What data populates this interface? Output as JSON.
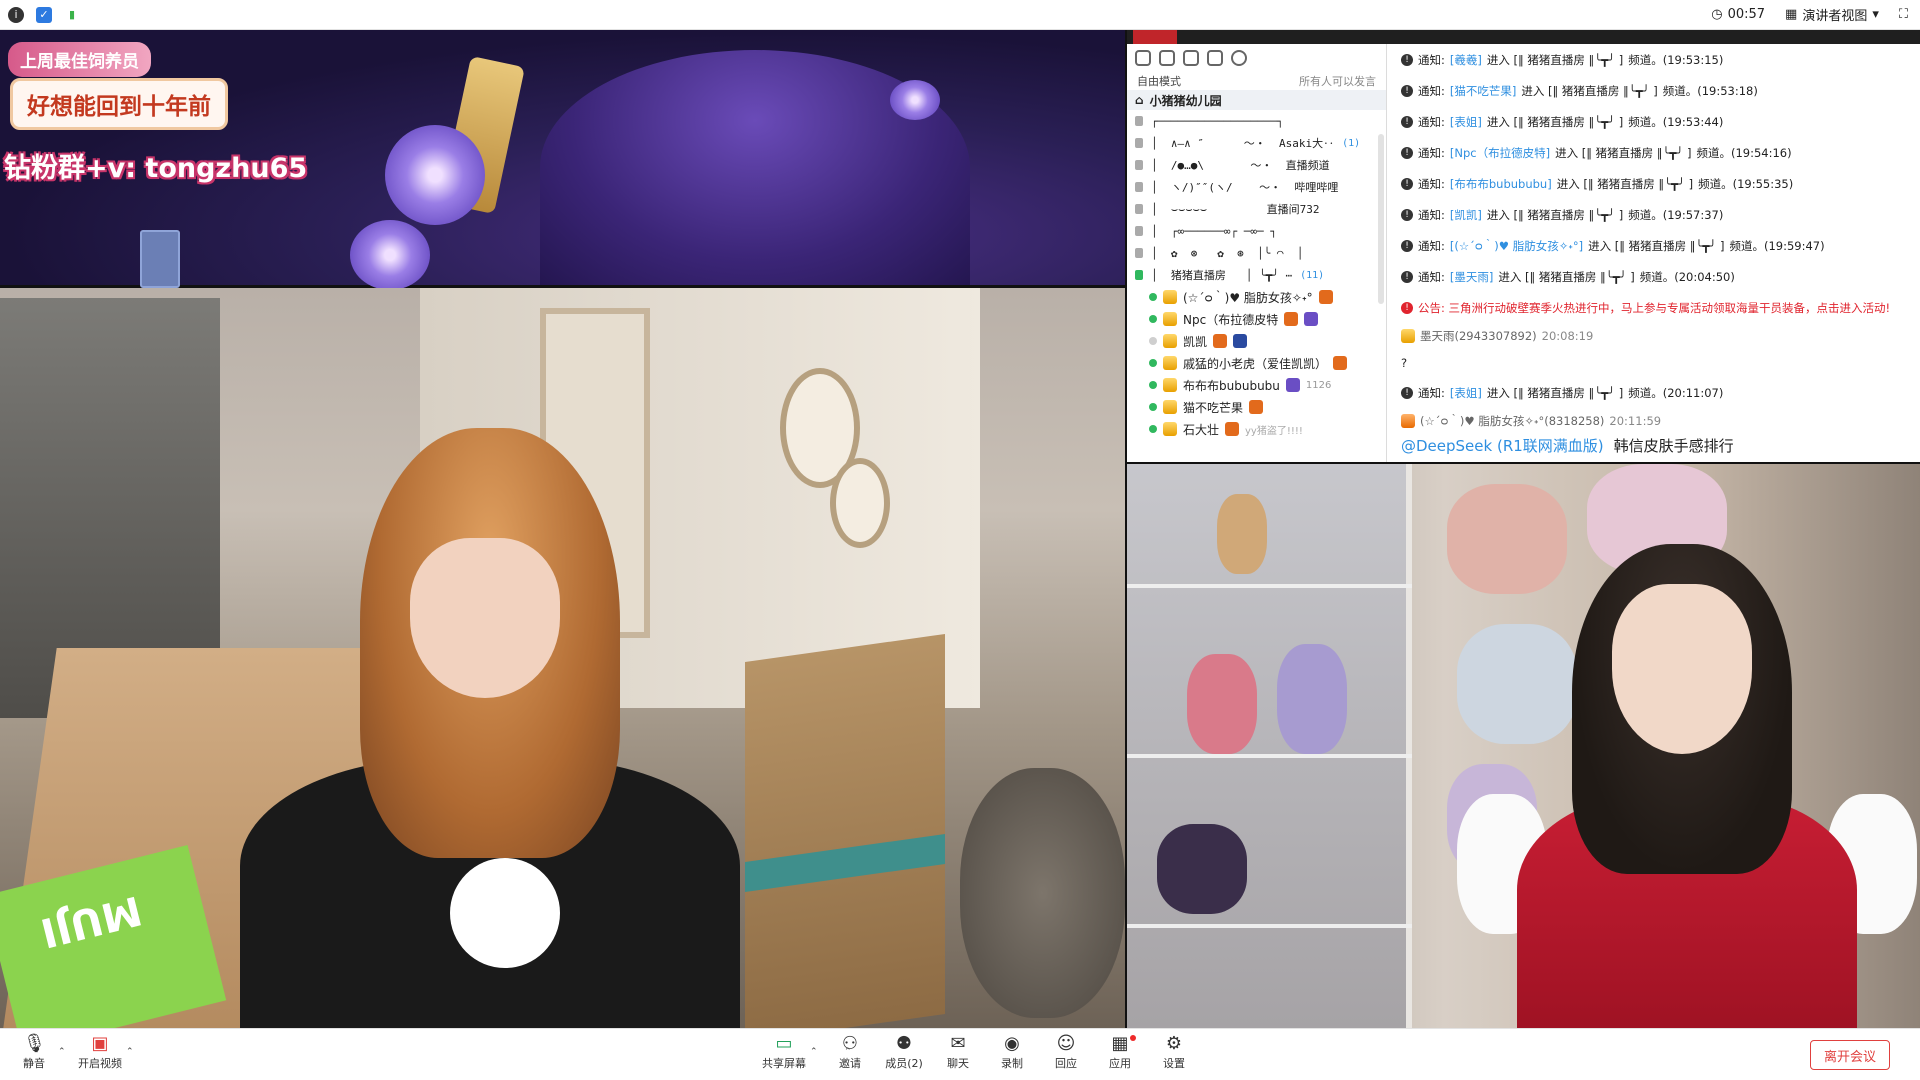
{
  "topbar": {
    "timer": "00:57",
    "view_label": "演讲者视图"
  },
  "left_video": {
    "overlay_title": "上周最佳饲养员",
    "overlay_slogan": "好想能回到十年前",
    "overlay_contact": "钻粉群+v: tongzhu65",
    "box_text": "MUJI"
  },
  "chat": {
    "mode_label": "自由模式",
    "mode_right": "所有人可以发言",
    "room_title": "小猪猪幼儿园",
    "art_rows": [
      "┌──────────────────┐",
      "│  ∧―∧ ″      ～・  Asaki大‥",
      "│  /●…●\\       ～・  直播频道",
      "│  ヽ/)″″(ヽ/    ～・  哔哩哔哩",
      "│  ⌣⌣⌣⌣⌣         直播间732",
      "│  ┌∞──────∞┌ ─∞─ ┐",
      "│  ✿  ⊛   ✿  ⊛  │╰ ◠  │"
    ],
    "art_extra": "(1)",
    "channel_row": {
      "text": "│  猪猪直播房   │ ╰┳╯ ⋯",
      "count": "(11)"
    },
    "members": [
      {
        "name": "(☆´ᴑ｀)♥ 脂肪女孩✧˖°",
        "online": true,
        "extra": ""
      },
      {
        "name": "Npc（布拉德皮特",
        "online": true,
        "extra": ""
      },
      {
        "name": "凯凯",
        "online": false,
        "extra": ""
      },
      {
        "name": "戚猛的小老虎（爱佳凯凯）",
        "online": true,
        "extra": ""
      },
      {
        "name": "布布布bubububu",
        "online": true,
        "extra": "1126"
      },
      {
        "name": "猫不吃芒果",
        "online": true,
        "extra": ""
      },
      {
        "name": "石大壮",
        "online": true,
        "extra": "yy猪盗了!!!!"
      }
    ],
    "messages": [
      {
        "type": "notice",
        "prefix": "通知:",
        "name": "[羲羲]",
        "mid": "进入 [‖ 猪猪直播房 ‖╰┳╯ ]",
        "suffix": "频道。(19:53:15)"
      },
      {
        "type": "notice",
        "prefix": "通知:",
        "name": "[猫不吃芒果]",
        "mid": "进入 [‖ 猪猪直播房 ‖╰┳╯ ]",
        "suffix": "频道。(19:53:18)"
      },
      {
        "type": "notice",
        "prefix": "通知:",
        "name": "[表姐]",
        "mid": "进入 [‖ 猪猪直播房 ‖╰┳╯ ]",
        "suffix": "频道。(19:53:44)"
      },
      {
        "type": "notice",
        "prefix": "通知:",
        "name": "[Npc（布拉德皮特]",
        "mid": "进入 [‖ 猪猪直播房 ‖╰┳╯ ]",
        "suffix": "频道。(19:54:16)"
      },
      {
        "type": "notice",
        "prefix": "通知:",
        "name": "[布布布bubububu]",
        "mid": "进入 [‖ 猪猪直播房 ‖╰┳╯ ]",
        "suffix": "频道。(19:55:35)"
      },
      {
        "type": "notice",
        "prefix": "通知:",
        "name": "[凯凯]",
        "mid": "进入 [‖ 猪猪直播房 ‖╰┳╯ ]",
        "suffix": "频道。(19:57:37)"
      },
      {
        "type": "notice",
        "prefix": "通知:",
        "name": "[(☆´ᴑ｀)♥ 脂肪女孩✧˖°]",
        "mid": "进入 [‖ 猪猪直播房 ‖╰┳╯ ]",
        "suffix": "频道。(19:59:47)"
      },
      {
        "type": "notice",
        "prefix": "通知:",
        "name": "[墨天雨]",
        "mid": "进入 [‖ 猪猪直播房 ‖╰┳╯ ]",
        "suffix": "频道。(20:04:50)"
      }
    ],
    "announcement": "公告: 三角洲行动破壁赛季火热进行中，马上参与专属活动领取海量干员装备，点击进入活动!",
    "user_msg": {
      "user": "墨天雨(2943307892)",
      "time": "20:08:19",
      "text": "?"
    },
    "notice_last": {
      "prefix": "通知:",
      "name": "[表姐]",
      "mid": "进入 [‖ 猪猪直播房 ‖╰┳╯ ]",
      "suffix": "频道。(20:11:07)"
    },
    "user_msg2": {
      "user": "(☆´ᴑ｀)♥ 脂肪女孩✧˖°(8318258)",
      "time": "20:11:59"
    },
    "at_line": {
      "mention": "@DeepSeek (R1联网满血版)",
      "text": "韩信皮肤手感排行"
    }
  },
  "toolbar": {
    "mute": "静音",
    "video": "开启视频",
    "share": "共享屏幕",
    "invite": "邀请",
    "members": "成员(2)",
    "chat": "聊天",
    "record": "录制",
    "react": "回应",
    "apps": "应用",
    "settings": "设置",
    "leave": "离开会议"
  }
}
